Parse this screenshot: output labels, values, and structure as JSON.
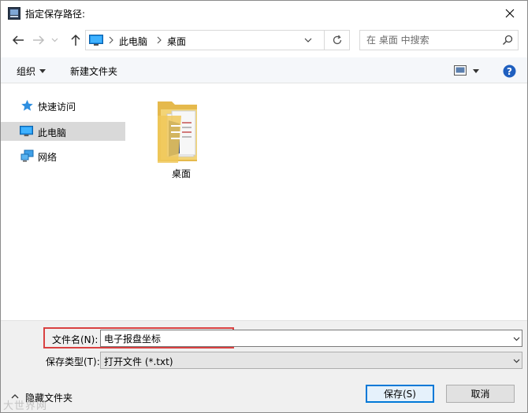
{
  "window": {
    "title": "指定保存路径:",
    "close_glyph": "✕"
  },
  "address": {
    "segments": [
      "此电脑",
      "桌面"
    ]
  },
  "search": {
    "placeholder": "在 桌面 中搜索"
  },
  "toolbar": {
    "organize_label": "组织",
    "new_folder_label": "新建文件夹"
  },
  "nav": {
    "items": [
      {
        "label": "快速访问",
        "icon": "star-icon"
      },
      {
        "label": "此电脑",
        "icon": "computer-icon",
        "selected": true
      },
      {
        "label": "网络",
        "icon": "network-icon"
      }
    ]
  },
  "content": {
    "items": [
      {
        "label": "桌面",
        "icon": "desktop-folder-icon"
      }
    ]
  },
  "form": {
    "filename_label": "文件名(N):",
    "filename_value": "电子报盘坐标",
    "filetype_label": "保存类型(T):",
    "filetype_value": "打开文件 (*.txt)"
  },
  "footer": {
    "hide_folders_label": "隐藏文件夹",
    "save_label": "保存(S)",
    "cancel_label": "取消",
    "watermark_text": "大世界网"
  },
  "colors": {
    "highlight_border": "#d94141",
    "primary_border": "#0078d7",
    "selected_bg": "#d9d9d9",
    "help_blue": "#1f5fbf"
  }
}
